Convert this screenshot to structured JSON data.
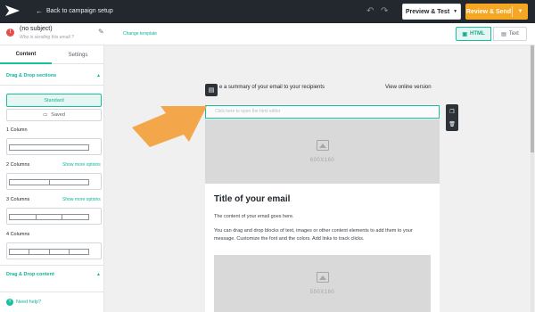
{
  "topbar": {
    "back_label": "Back to campaign setup",
    "preview_label": "Preview & Test",
    "review_label": "Review & Send"
  },
  "subbar": {
    "subject": "(no subject)",
    "sender_placeholder": "Who is sending this email ?",
    "change_template": "Change template",
    "html_label": "HTML",
    "text_label": "Text"
  },
  "sidebar": {
    "tabs": [
      "Content",
      "Settings"
    ],
    "dnd_sections": "Drag & Drop sections",
    "standard": "Standard",
    "saved": "Saved",
    "columns": [
      {
        "label": "1 Column",
        "count": 1,
        "show_more": ""
      },
      {
        "label": "2 Columns",
        "count": 2,
        "show_more": "Show more options"
      },
      {
        "label": "3 Columns",
        "count": 3,
        "show_more": "Show more options"
      },
      {
        "label": "4 Columns",
        "count": 4,
        "show_more": ""
      }
    ],
    "dnd_content": "Drag & Drop content",
    "help": "Need help?"
  },
  "editor": {
    "preheader": "e a summary of your email to your recipients",
    "view_online": "View online version",
    "html_placeholder": "Click here to open the html editor",
    "img1_size": "600X160",
    "title": "Title of your email",
    "body1": "The content of your email goes here.",
    "body2": "You can drag and drop blocks of text, images or other content elements to add them to your message. Customize the font and the colors. Add links to track clicks.",
    "img2_size": "550X160"
  },
  "colors": {
    "accent": "#18c0a1",
    "review": "#f5a623",
    "topbar": "#22282e",
    "arrow": "#f4a64a"
  },
  "icons": [
    "logo-icon",
    "back-arrow-icon",
    "undo-icon",
    "redo-icon",
    "warning-icon",
    "pencil-icon",
    "html-icon",
    "text-icon",
    "image-icon",
    "help-icon",
    "comment-icon",
    "copy-icon",
    "trash-icon"
  ]
}
